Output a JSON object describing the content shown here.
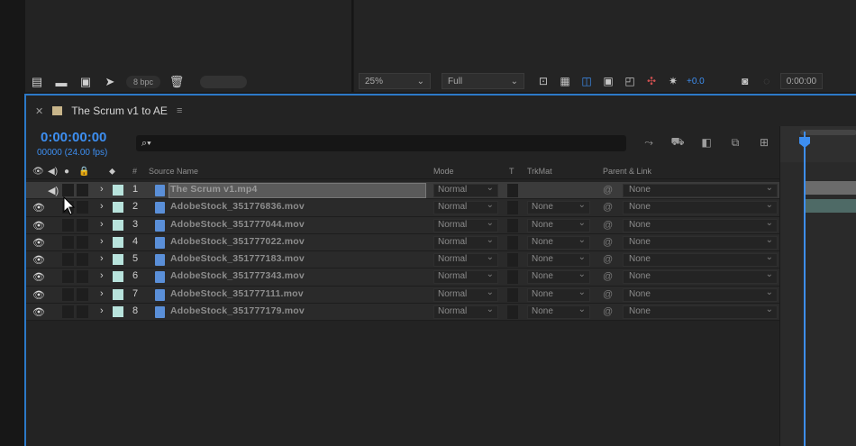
{
  "project_toolbar": {
    "bpc_label": "8 bpc"
  },
  "viewer_toolbar": {
    "zoom": "25%",
    "resolution": "Full",
    "exposure": "+0.0",
    "timecode": "0:00:00"
  },
  "timeline": {
    "tab_title": "The Scrum v1 to AE",
    "current_time": "0:00:00:00",
    "frame_info": "00000 (24.00 fps)",
    "search_placeholder": "",
    "columns": {
      "number": "#",
      "source_name": "Source Name",
      "mode": "Mode",
      "trkmat": "T",
      "trackmatte": "TrkMat",
      "parent": "Parent & Link"
    },
    "layers": [
      {
        "num": "1",
        "name": "The Scrum v1.mp4",
        "mode": "Normal",
        "trkmat": "",
        "parent": "None"
      },
      {
        "num": "2",
        "name": "AdobeStock_351776836.mov",
        "mode": "Normal",
        "trkmat": "None",
        "parent": "None"
      },
      {
        "num": "3",
        "name": "AdobeStock_351777044.mov",
        "mode": "Normal",
        "trkmat": "None",
        "parent": "None"
      },
      {
        "num": "4",
        "name": "AdobeStock_351777022.mov",
        "mode": "Normal",
        "trkmat": "None",
        "parent": "None"
      },
      {
        "num": "5",
        "name": "AdobeStock_351777183.mov",
        "mode": "Normal",
        "trkmat": "None",
        "parent": "None"
      },
      {
        "num": "6",
        "name": "AdobeStock_351777343.mov",
        "mode": "Normal",
        "trkmat": "None",
        "parent": "None"
      },
      {
        "num": "7",
        "name": "AdobeStock_351777111.mov",
        "mode": "Normal",
        "trkmat": "None",
        "parent": "None"
      },
      {
        "num": "8",
        "name": "AdobeStock_351777179.mov",
        "mode": "Normal",
        "trkmat": "None",
        "parent": "None"
      }
    ]
  },
  "colors": {
    "accent": "#3d8ef0",
    "label": "#b8e3dc",
    "comp_swatch": "#c8b58a"
  }
}
